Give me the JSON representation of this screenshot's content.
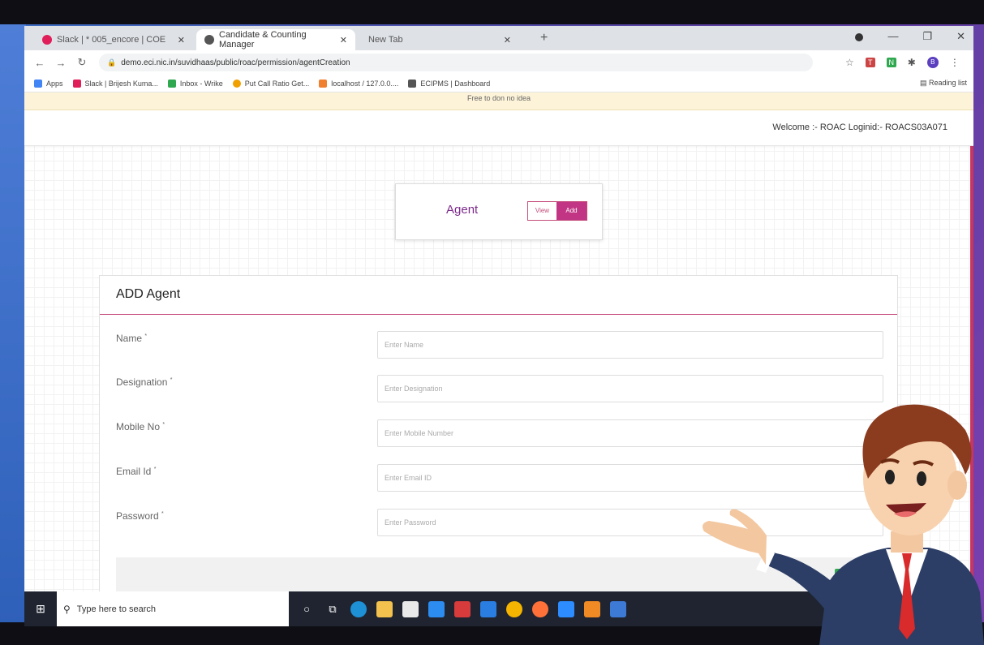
{
  "browser": {
    "tabs": [
      {
        "label": "Slack | * 005_encore | COE",
        "color": "#e01e5a"
      },
      {
        "label": "Candidate & Counting Manager",
        "color": "#555555"
      },
      {
        "label": "New Tab",
        "color": "#888888"
      }
    ],
    "new_tab": "+",
    "url": "demo.eci.nic.in/suvidhaas/public/roac/permission/agentCreation",
    "bookmarks": [
      {
        "label": "Apps",
        "color": "#4285f4"
      },
      {
        "label": "Slack | Brijesh Kuma...",
        "color": "#e01e5a"
      },
      {
        "label": "Inbox - Wrike",
        "color": "#2fa84f"
      },
      {
        "label": "Put Call Ratio Get...",
        "color": "#f0a000"
      },
      {
        "label": "localhost / 127.0.0....",
        "color": "#f08030"
      },
      {
        "label": "ECIPMS | Dashboard",
        "color": "#555555"
      }
    ],
    "reading_list": "Reading list",
    "profile_initial": "B"
  },
  "page": {
    "notice": "Free to don no idea",
    "welcome": "Welcome :- ROAC Loginid:- ROACS03A071",
    "agent_title": "Agent",
    "toggle": {
      "view": "View",
      "add": "Add"
    },
    "form": {
      "heading": "ADD Agent",
      "fields": [
        {
          "label": "Name",
          "required": "*",
          "placeholder": "Enter Name"
        },
        {
          "label": "Designation",
          "required": "*",
          "placeholder": "Enter Designation"
        },
        {
          "label": "Mobile No",
          "required": "*",
          "placeholder": "Enter Mobile Number"
        },
        {
          "label": "Email Id",
          "required": "*",
          "placeholder": "Enter Email ID"
        },
        {
          "label": "Password",
          "required": "*",
          "placeholder": "Enter Password"
        }
      ]
    }
  },
  "taskbar": {
    "search_placeholder": "Type here to search",
    "apps": [
      {
        "name": "edge",
        "color": "#1e90d6"
      },
      {
        "name": "file-explorer",
        "color": "#f2c14e"
      },
      {
        "name": "store",
        "color": "#e9e9e9"
      },
      {
        "name": "app-l",
        "color": "#2d8cf0"
      },
      {
        "name": "app-red",
        "color": "#d83b3b"
      },
      {
        "name": "mail",
        "color": "#2a7de1"
      },
      {
        "name": "chrome",
        "color": "#f4b400"
      },
      {
        "name": "firefox",
        "color": "#ff7139"
      },
      {
        "name": "zoom",
        "color": "#2d8cff"
      },
      {
        "name": "app-orange",
        "color": "#f08a24"
      },
      {
        "name": "app-blue",
        "color": "#3d7ad6"
      }
    ]
  },
  "colors": {
    "accent": "#c13584",
    "agent_title": "#7b2a8a",
    "save": "#2fa84f"
  }
}
